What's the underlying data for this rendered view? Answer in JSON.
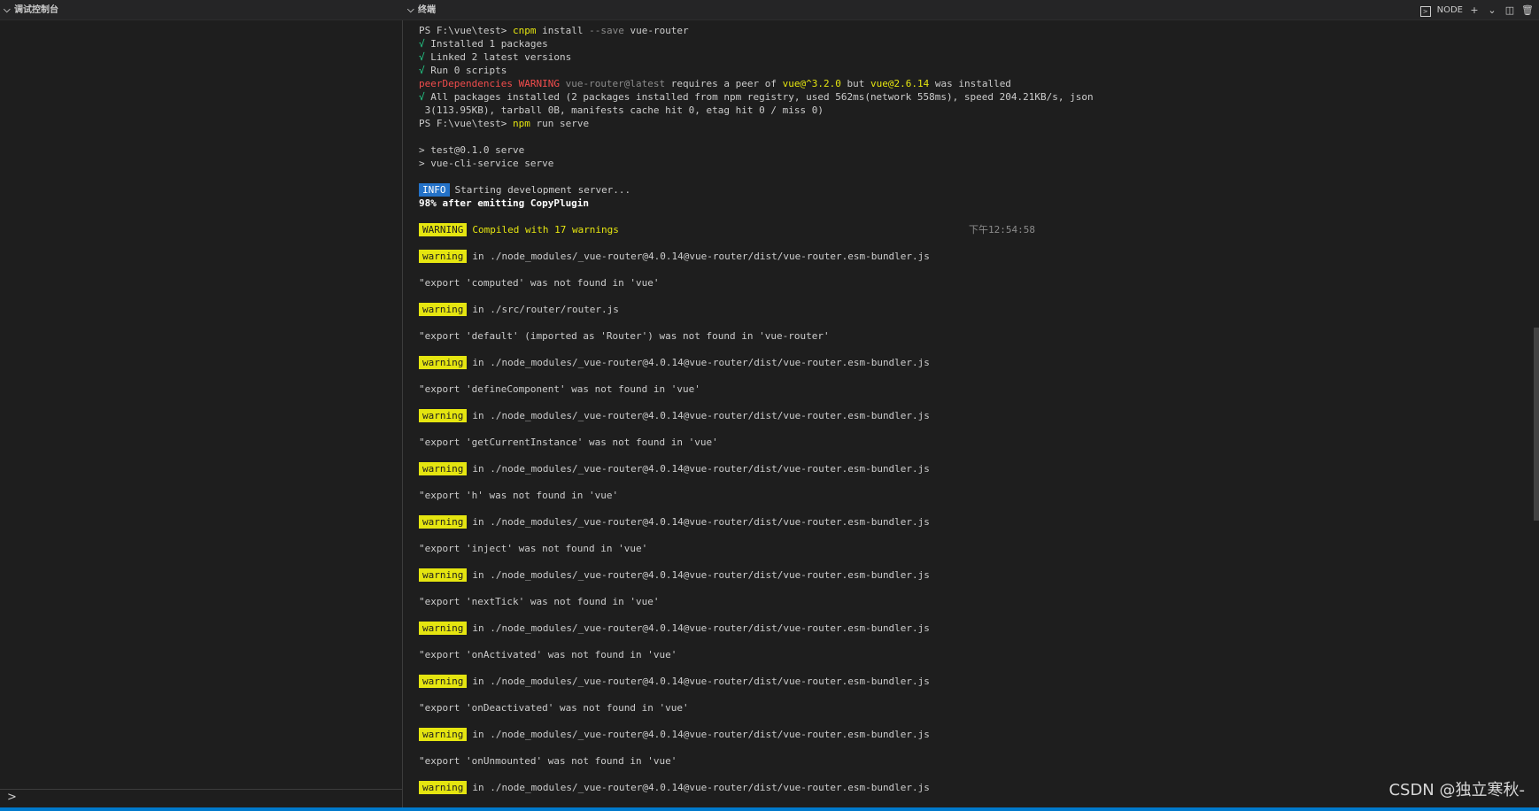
{
  "left_panel": {
    "title": "调试控制台",
    "prompt": ">"
  },
  "terminal_panel": {
    "title": "终端"
  },
  "toolbar": {
    "shell_label": "NODE",
    "add": "+",
    "dropdown": "⌄",
    "split": "◫",
    "trash": "🗑"
  },
  "lines": [
    {
      "segs": [
        [
          "PS F:\\vue\\test> ",
          ""
        ],
        [
          "cnpm",
          "cmd"
        ],
        [
          " install ",
          ""
        ],
        [
          "--save",
          "dim"
        ],
        [
          " vue-router",
          ""
        ]
      ]
    },
    {
      "segs": [
        [
          "√",
          "green"
        ],
        [
          " Installed 1 packages",
          ""
        ]
      ]
    },
    {
      "segs": [
        [
          "√",
          "green"
        ],
        [
          " Linked 2 latest versions",
          ""
        ]
      ]
    },
    {
      "segs": [
        [
          "√",
          "green"
        ],
        [
          " Run 0 scripts",
          ""
        ]
      ]
    },
    {
      "segs": [
        [
          "peerDependencies WARNING ",
          "red"
        ],
        [
          "vue-router@latest",
          "dim"
        ],
        [
          " requires a peer of ",
          ""
        ],
        [
          "vue@^3.2.0",
          "yellow"
        ],
        [
          " but ",
          ""
        ],
        [
          "vue@2.6.14",
          "yellow"
        ],
        [
          " was installed",
          ""
        ]
      ]
    },
    {
      "segs": [
        [
          "√",
          "green"
        ],
        [
          " All packages installed (2 packages installed from npm registry, used 562ms(network 558ms), speed 204.21KB/s, json",
          ""
        ]
      ]
    },
    {
      "segs": [
        [
          " 3(113.95KB), tarball 0B, manifests cache hit 0, etag hit 0 / miss 0)",
          ""
        ]
      ]
    },
    {
      "segs": [
        [
          "PS F:\\vue\\test> ",
          ""
        ],
        [
          "npm",
          "cmd"
        ],
        [
          " run serve",
          ""
        ]
      ]
    },
    {
      "segs": []
    },
    {
      "segs": [
        [
          "> test@0.1.0 serve",
          ""
        ]
      ]
    },
    {
      "segs": [
        [
          "> vue-cli-service serve",
          ""
        ]
      ]
    },
    {
      "segs": []
    },
    {
      "tag": "INFO",
      "tagclass": "tag-info",
      "segs": [
        [
          "Starting development server...",
          ""
        ]
      ]
    },
    {
      "segs": [
        [
          "98% after emitting CopyPlugin",
          "bold"
        ]
      ]
    },
    {
      "segs": []
    },
    {
      "tag": "WARNING",
      "tagclass": "tag-warn",
      "segs": [
        [
          "Compiled with 17 warnings",
          "yellow"
        ]
      ],
      "time": "下午12:54:58"
    },
    {
      "segs": []
    },
    {
      "tag": "warning",
      "tagclass": "tag-warn",
      "segs": [
        [
          "in ./node_modules/_vue-router@4.0.14@vue-router/dist/vue-router.esm-bundler.js",
          ""
        ]
      ]
    },
    {
      "segs": []
    },
    {
      "segs": [
        [
          "\"export 'computed' was not found in 'vue'",
          ""
        ]
      ]
    },
    {
      "segs": []
    },
    {
      "tag": "warning",
      "tagclass": "tag-warn",
      "segs": [
        [
          "in ./src/router/router.js",
          ""
        ]
      ]
    },
    {
      "segs": []
    },
    {
      "segs": [
        [
          "\"export 'default' (imported as 'Router') was not found in 'vue-router'",
          ""
        ]
      ]
    },
    {
      "segs": []
    },
    {
      "tag": "warning",
      "tagclass": "tag-warn",
      "segs": [
        [
          "in ./node_modules/_vue-router@4.0.14@vue-router/dist/vue-router.esm-bundler.js",
          ""
        ]
      ]
    },
    {
      "segs": []
    },
    {
      "segs": [
        [
          "\"export 'defineComponent' was not found in 'vue'",
          ""
        ]
      ]
    },
    {
      "segs": []
    },
    {
      "tag": "warning",
      "tagclass": "tag-warn",
      "segs": [
        [
          "in ./node_modules/_vue-router@4.0.14@vue-router/dist/vue-router.esm-bundler.js",
          ""
        ]
      ]
    },
    {
      "segs": []
    },
    {
      "segs": [
        [
          "\"export 'getCurrentInstance' was not found in 'vue'",
          ""
        ]
      ]
    },
    {
      "segs": []
    },
    {
      "tag": "warning",
      "tagclass": "tag-warn",
      "segs": [
        [
          "in ./node_modules/_vue-router@4.0.14@vue-router/dist/vue-router.esm-bundler.js",
          ""
        ]
      ]
    },
    {
      "segs": []
    },
    {
      "segs": [
        [
          "\"export 'h' was not found in 'vue'",
          ""
        ]
      ]
    },
    {
      "segs": []
    },
    {
      "tag": "warning",
      "tagclass": "tag-warn",
      "segs": [
        [
          "in ./node_modules/_vue-router@4.0.14@vue-router/dist/vue-router.esm-bundler.js",
          ""
        ]
      ]
    },
    {
      "segs": []
    },
    {
      "segs": [
        [
          "\"export 'inject' was not found in 'vue'",
          ""
        ]
      ]
    },
    {
      "segs": []
    },
    {
      "tag": "warning",
      "tagclass": "tag-warn",
      "segs": [
        [
          "in ./node_modules/_vue-router@4.0.14@vue-router/dist/vue-router.esm-bundler.js",
          ""
        ]
      ]
    },
    {
      "segs": []
    },
    {
      "segs": [
        [
          "\"export 'nextTick' was not found in 'vue'",
          ""
        ]
      ]
    },
    {
      "segs": []
    },
    {
      "tag": "warning",
      "tagclass": "tag-warn",
      "segs": [
        [
          "in ./node_modules/_vue-router@4.0.14@vue-router/dist/vue-router.esm-bundler.js",
          ""
        ]
      ]
    },
    {
      "segs": []
    },
    {
      "segs": [
        [
          "\"export 'onActivated' was not found in 'vue'",
          ""
        ]
      ]
    },
    {
      "segs": []
    },
    {
      "tag": "warning",
      "tagclass": "tag-warn",
      "segs": [
        [
          "in ./node_modules/_vue-router@4.0.14@vue-router/dist/vue-router.esm-bundler.js",
          ""
        ]
      ]
    },
    {
      "segs": []
    },
    {
      "segs": [
        [
          "\"export 'onDeactivated' was not found in 'vue'",
          ""
        ]
      ]
    },
    {
      "segs": []
    },
    {
      "tag": "warning",
      "tagclass": "tag-warn",
      "segs": [
        [
          "in ./node_modules/_vue-router@4.0.14@vue-router/dist/vue-router.esm-bundler.js",
          ""
        ]
      ]
    },
    {
      "segs": []
    },
    {
      "segs": [
        [
          "\"export 'onUnmounted' was not found in 'vue'",
          ""
        ]
      ]
    },
    {
      "segs": []
    },
    {
      "tag": "warning",
      "tagclass": "tag-warn",
      "segs": [
        [
          "in ./node_modules/_vue-router@4.0.14@vue-router/dist/vue-router.esm-bundler.js",
          ""
        ]
      ]
    }
  ],
  "watermark": "CSDN @独立寒秋-"
}
